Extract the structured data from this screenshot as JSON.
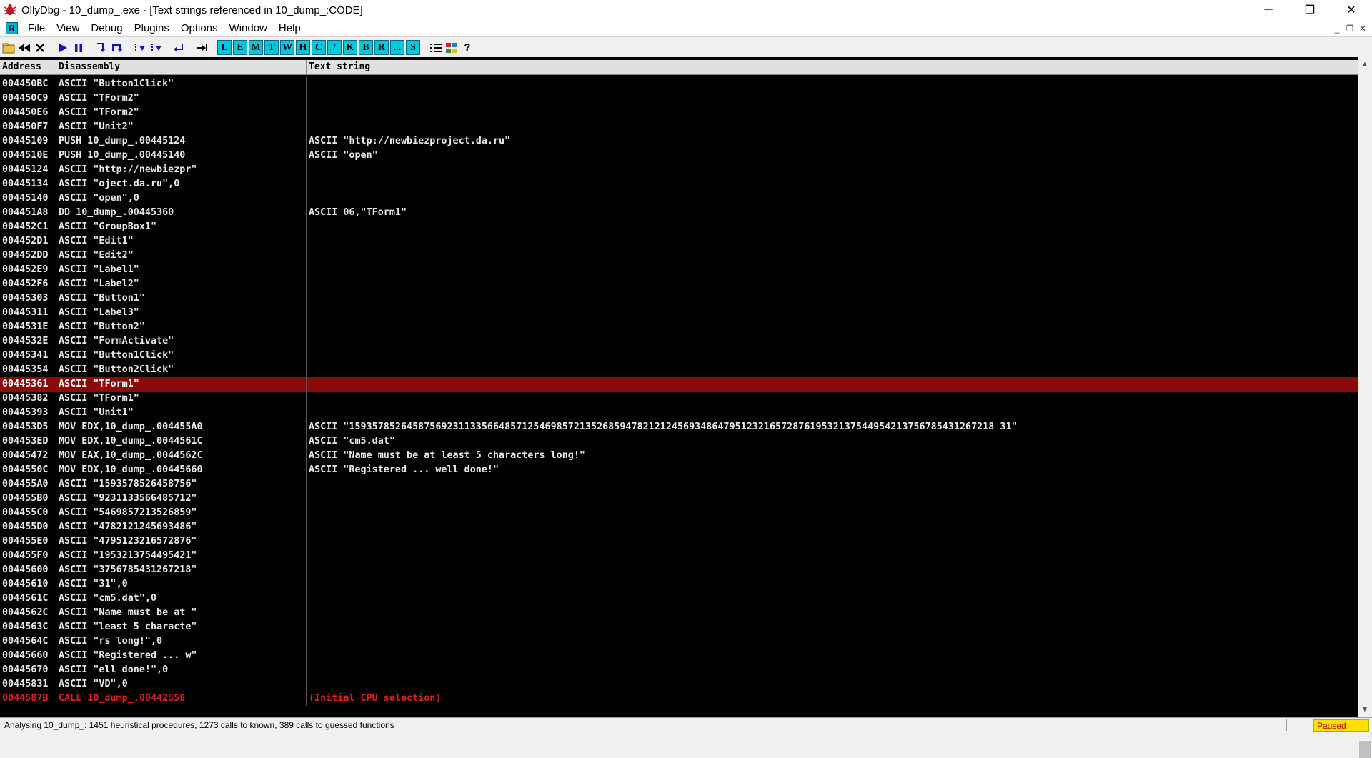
{
  "window": {
    "title": "OllyDbg - 10_dump_.exe - [Text strings referenced in 10_dump_:CODE]",
    "minimize": "─",
    "restore": "❐",
    "close": "✕"
  },
  "menu": {
    "r_label": "R",
    "items": [
      {
        "label": "File",
        "key": "F"
      },
      {
        "label": "View",
        "key": "V"
      },
      {
        "label": "Debug",
        "key": "D"
      },
      {
        "label": "Plugins",
        "key": "P"
      },
      {
        "label": "Options",
        "key": "t"
      },
      {
        "label": "Window",
        "key": "W"
      },
      {
        "label": "Help",
        "key": "H"
      }
    ],
    "mdi": [
      "_",
      "❐",
      "✕"
    ]
  },
  "toolbar": {
    "letters": [
      "L",
      "E",
      "M",
      "T",
      "W",
      "H",
      "C",
      "/",
      "K",
      "B",
      "R",
      "...",
      "S"
    ]
  },
  "table": {
    "headers": {
      "address": "Address",
      "disassembly": "Disassembly",
      "text": "Text string"
    },
    "rows": [
      {
        "addr": "004450BC",
        "dis": "ASCII \"Button1Click\"",
        "txt": ""
      },
      {
        "addr": "004450C9",
        "dis": "ASCII \"TForm2\"",
        "txt": ""
      },
      {
        "addr": "004450E6",
        "dis": "ASCII \"TForm2\"",
        "txt": ""
      },
      {
        "addr": "004450F7",
        "dis": "ASCII \"Unit2\"",
        "txt": ""
      },
      {
        "addr": "00445109",
        "dis": "PUSH 10_dump_.00445124",
        "txt": "ASCII \"http://newbiezproject.da.ru\""
      },
      {
        "addr": "0044510E",
        "dis": "PUSH 10_dump_.00445140",
        "txt": "ASCII \"open\""
      },
      {
        "addr": "00445124",
        "dis": "ASCII \"http://newbiezpr\"",
        "txt": ""
      },
      {
        "addr": "00445134",
        "dis": "ASCII \"oject.da.ru\",0",
        "txt": ""
      },
      {
        "addr": "00445140",
        "dis": "ASCII \"open\",0",
        "txt": ""
      },
      {
        "addr": "004451A8",
        "dis": "DD 10_dump_.00445360",
        "txt": "ASCII 06,\"TForm1\""
      },
      {
        "addr": "004452C1",
        "dis": "ASCII \"GroupBox1\"",
        "txt": ""
      },
      {
        "addr": "004452D1",
        "dis": "ASCII \"Edit1\"",
        "txt": ""
      },
      {
        "addr": "004452DD",
        "dis": "ASCII \"Edit2\"",
        "txt": ""
      },
      {
        "addr": "004452E9",
        "dis": "ASCII \"Label1\"",
        "txt": ""
      },
      {
        "addr": "004452F6",
        "dis": "ASCII \"Label2\"",
        "txt": ""
      },
      {
        "addr": "00445303",
        "dis": "ASCII \"Button1\"",
        "txt": ""
      },
      {
        "addr": "00445311",
        "dis": "ASCII \"Label3\"",
        "txt": ""
      },
      {
        "addr": "0044531E",
        "dis": "ASCII \"Button2\"",
        "txt": ""
      },
      {
        "addr": "0044532E",
        "dis": "ASCII \"FormActivate\"",
        "txt": ""
      },
      {
        "addr": "00445341",
        "dis": "ASCII \"Button1Click\"",
        "txt": ""
      },
      {
        "addr": "00445354",
        "dis": "ASCII \"Button2Click\"",
        "txt": ""
      },
      {
        "addr": "00445361",
        "dis": "ASCII \"TForm1\"",
        "txt": "",
        "state": "selected"
      },
      {
        "addr": "00445382",
        "dis": "ASCII \"TForm1\"",
        "txt": ""
      },
      {
        "addr": "00445393",
        "dis": "ASCII \"Unit1\"",
        "txt": ""
      },
      {
        "addr": "004453D5",
        "dis": "MOV EDX,10_dump_.004455A0",
        "txt": "ASCII \"1593578526458756923113356648571254698572135268594782121245693486479512321657287619532137544954213756785431267218 31\""
      },
      {
        "addr": "004453ED",
        "dis": "MOV EDX,10_dump_.0044561C",
        "txt": "ASCII \"cm5.dat\""
      },
      {
        "addr": "00445472",
        "dis": "MOV EAX,10_dump_.0044562C",
        "txt": "ASCII \"Name must be at least 5 characters long!\""
      },
      {
        "addr": "0044550C",
        "dis": "MOV EDX,10_dump_.00445660",
        "txt": "ASCII \"Registered ... well done!\""
      },
      {
        "addr": "004455A0",
        "dis": "ASCII \"1593578526458756\"",
        "txt": ""
      },
      {
        "addr": "004455B0",
        "dis": "ASCII \"9231133566485712\"",
        "txt": ""
      },
      {
        "addr": "004455C0",
        "dis": "ASCII \"5469857213526859\"",
        "txt": ""
      },
      {
        "addr": "004455D0",
        "dis": "ASCII \"4782121245693486\"",
        "txt": ""
      },
      {
        "addr": "004455E0",
        "dis": "ASCII \"4795123216572876\"",
        "txt": ""
      },
      {
        "addr": "004455F0",
        "dis": "ASCII \"1953213754495421\"",
        "txt": ""
      },
      {
        "addr": "00445600",
        "dis": "ASCII \"3756785431267218\"",
        "txt": ""
      },
      {
        "addr": "00445610",
        "dis": "ASCII \"31\",0",
        "txt": ""
      },
      {
        "addr": "0044561C",
        "dis": "ASCII \"cm5.dat\",0",
        "txt": ""
      },
      {
        "addr": "0044562C",
        "dis": "ASCII \"Name must be at \"",
        "txt": ""
      },
      {
        "addr": "0044563C",
        "dis": "ASCII \"least 5 characte\"",
        "txt": ""
      },
      {
        "addr": "0044564C",
        "dis": "ASCII \"rs long!\",0",
        "txt": ""
      },
      {
        "addr": "00445660",
        "dis": "ASCII \"Registered ... w\"",
        "txt": ""
      },
      {
        "addr": "00445670",
        "dis": "ASCII \"ell done!\",0",
        "txt": ""
      },
      {
        "addr": "00445831",
        "dis": "ASCII \"VD\",0",
        "txt": ""
      },
      {
        "addr": "0044587B",
        "dis": "CALL 10_dump_.00442558",
        "txt": "(Initial CPU selection)",
        "state": "red"
      }
    ]
  },
  "status": {
    "message": "Analysing 10_dump_: 1451 heuristical procedures, 1273 calls to known, 389 calls to guessed functions",
    "state": "Paused"
  },
  "colors": {
    "selected_row": "#8b0a0a",
    "highlight_text": "#e02020",
    "paused_bg": "#ffe000"
  }
}
